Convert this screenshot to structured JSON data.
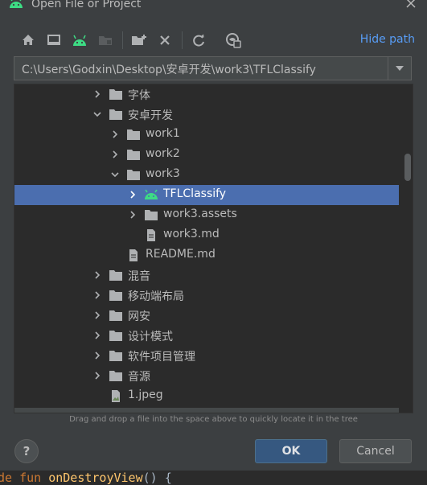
{
  "dialog": {
    "title": "Open File or Project",
    "hide_path_label": "Hide path",
    "path_value": "C:\\Users\\Godxin\\Desktop\\安卓开发\\work3\\TFLClassify",
    "hint": "Drag and drop a file into the space above to quickly locate it in the tree",
    "help_label": "?",
    "ok_label": "OK",
    "cancel_label": "Cancel"
  },
  "toolbar": {
    "icons": [
      "home-icon",
      "desktop-icon",
      "android-project-icon",
      "module-icon",
      "new-folder-icon",
      "delete-icon",
      "refresh-icon",
      "show-hidden-icon"
    ]
  },
  "tree": {
    "items": [
      {
        "label": "字体",
        "indent": 1,
        "expanded": false,
        "kind": "folder"
      },
      {
        "label": "安卓开发",
        "indent": 1,
        "expanded": true,
        "kind": "folder"
      },
      {
        "label": "work1",
        "indent": 2,
        "expanded": false,
        "kind": "folder"
      },
      {
        "label": "work2",
        "indent": 2,
        "expanded": false,
        "kind": "folder"
      },
      {
        "label": "work3",
        "indent": 2,
        "expanded": true,
        "kind": "folder"
      },
      {
        "label": "TFLClassify",
        "indent": 3,
        "expanded": false,
        "kind": "android",
        "selected": true
      },
      {
        "label": "work3.assets",
        "indent": 3,
        "expanded": false,
        "kind": "folder"
      },
      {
        "label": "work3.md",
        "indent": 3,
        "kind": "file"
      },
      {
        "label": "README.md",
        "indent": 2,
        "kind": "file"
      },
      {
        "label": "混音",
        "indent": 1,
        "expanded": false,
        "kind": "folder"
      },
      {
        "label": "移动端布局",
        "indent": 1,
        "expanded": false,
        "kind": "folder"
      },
      {
        "label": "网安",
        "indent": 1,
        "expanded": false,
        "kind": "folder"
      },
      {
        "label": "设计模式",
        "indent": 1,
        "expanded": false,
        "kind": "folder"
      },
      {
        "label": "软件项目管理",
        "indent": 1,
        "expanded": false,
        "kind": "folder"
      },
      {
        "label": "音源",
        "indent": 1,
        "expanded": false,
        "kind": "folder"
      },
      {
        "label": "1.jpeg",
        "indent": 1,
        "kind": "image"
      }
    ]
  },
  "editor": {
    "keyword": "de fun ",
    "function": "onDestroyView",
    "rest": "() {"
  },
  "colors": {
    "accent": "#589df6",
    "selection": "#4b6eaf",
    "android_green": "#3ddc84",
    "ok_button": "#365880"
  }
}
